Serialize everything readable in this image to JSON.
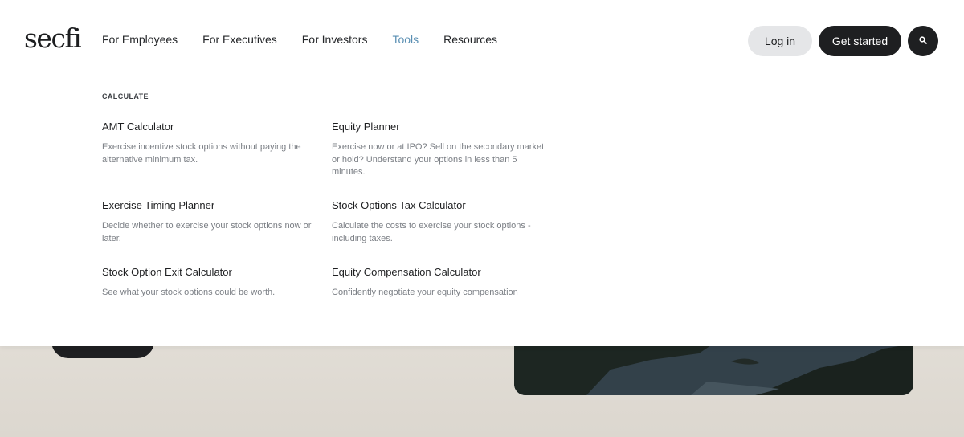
{
  "brand": {
    "logo_text": "secfi"
  },
  "nav": {
    "items": [
      {
        "label": "For Employees",
        "active": false
      },
      {
        "label": "For Executives",
        "active": false
      },
      {
        "label": "For Investors",
        "active": false
      },
      {
        "label": "Tools",
        "active": true
      },
      {
        "label": "Resources",
        "active": false
      }
    ]
  },
  "actions": {
    "login_label": "Log in",
    "get_started_label": "Get started",
    "search_icon": "search-icon"
  },
  "menu": {
    "section_label": "CALCULATE",
    "items": [
      {
        "title": "AMT Calculator",
        "description": "Exercise incentive stock options without paying the alternative minimum tax."
      },
      {
        "title": "Equity Planner",
        "description": "Exercise now or at IPO? Sell on the secondary market or hold? Understand your options in less than 5 minutes."
      },
      {
        "title": "Exercise Timing Planner",
        "description": "Decide whether to exercise your stock options now or later."
      },
      {
        "title": "Stock Options Tax Calculator",
        "description": "Calculate the costs to exercise your stock options - including taxes."
      },
      {
        "title": "Stock Option Exit Calculator",
        "description": "See what your stock options could be worth."
      },
      {
        "title": "Equity Compensation Calculator",
        "description": "Confidently negotiate your equity compensation"
      }
    ]
  },
  "colors": {
    "accent_active": "#5a8fb3",
    "dark_button": "#1e1f21",
    "light_button": "#e5e6e8"
  }
}
